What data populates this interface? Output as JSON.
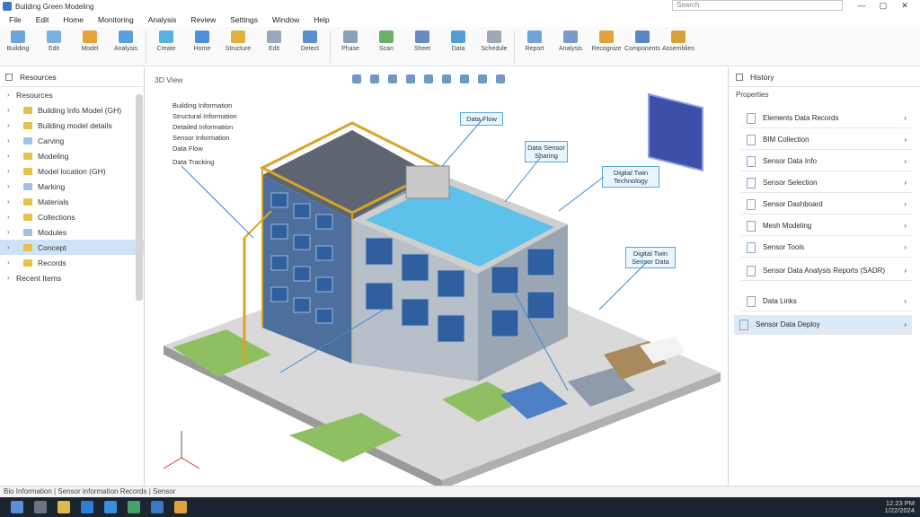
{
  "window": {
    "title": "Building Green Modeling",
    "search_placeholder": "Search",
    "controls": [
      "—",
      "▢",
      "✕"
    ]
  },
  "menu": [
    "File",
    "Edit",
    "Home",
    "Monitoring",
    "Analysis",
    "Review",
    "Settings",
    "Window",
    "Help"
  ],
  "ribbon": [
    {
      "label": "Building",
      "icon": "building-icon"
    },
    {
      "label": "Edit",
      "icon": "pencil-icon"
    },
    {
      "label": "Model",
      "icon": "box-icon"
    },
    {
      "label": "Analysis",
      "icon": "globe-icon"
    },
    {
      "label": "Create",
      "icon": "cube-icon"
    },
    {
      "label": "Home",
      "icon": "cube-icon"
    },
    {
      "label": "Structure",
      "icon": "beam-icon"
    },
    {
      "label": "Edit",
      "icon": "list-icon"
    },
    {
      "label": "Detect",
      "icon": "layers-icon"
    },
    {
      "label": "Phase",
      "icon": "phase-icon"
    },
    {
      "label": "Scan",
      "icon": "leaf-icon"
    },
    {
      "label": "Sheet",
      "icon": "sheet-icon"
    },
    {
      "label": "Data",
      "icon": "chart-icon"
    },
    {
      "label": "Schedule",
      "icon": "tag-icon"
    },
    {
      "label": "Report",
      "icon": "doc-icon"
    },
    {
      "label": "Analysis",
      "icon": "doc-icon"
    },
    {
      "label": "Recognize",
      "icon": "cube-icon"
    },
    {
      "label": "Components",
      "icon": "stack-icon"
    },
    {
      "label": "Assemblies",
      "icon": "gear-icon"
    }
  ],
  "left_panel": {
    "title": "Resources",
    "items": [
      {
        "label": "Resources",
        "folder": false,
        "selected": false
      },
      {
        "label": "Building Info Model (GH)",
        "folder": true,
        "selected": false
      },
      {
        "label": "Building model details",
        "folder": true,
        "selected": false
      },
      {
        "label": "Carving",
        "folder": true,
        "selected": false
      },
      {
        "label": "Modeling",
        "folder": true,
        "selected": false
      },
      {
        "label": "Model location (GH)",
        "folder": true,
        "selected": false
      },
      {
        "label": "Marking",
        "folder": true,
        "selected": false
      },
      {
        "label": "Materials",
        "folder": true,
        "selected": false
      },
      {
        "label": "Collections",
        "folder": true,
        "selected": false
      },
      {
        "label": "Modules",
        "folder": true,
        "selected": false
      },
      {
        "label": "Concept",
        "folder": true,
        "selected": true
      },
      {
        "label": "Records",
        "folder": true,
        "selected": false
      },
      {
        "label": "Recent Items",
        "folder": false,
        "selected": false
      }
    ]
  },
  "viewport": {
    "label": "3D View",
    "annotations": [
      "Building Information",
      "Structural Information",
      "Detailed Information",
      "Sensor Information",
      "Data Flow",
      "Data Tracking"
    ],
    "callouts": [
      "Data Flow",
      "Data Sensor Sharing",
      "Digital Twin Technology",
      "Digital Twin Sensor Data"
    ]
  },
  "right_panel": {
    "title": "History",
    "subtitle": "Properties",
    "items": [
      {
        "label": "Elements Data Records",
        "selected": false
      },
      {
        "label": "BIM Collection",
        "selected": false
      },
      {
        "label": "Sensor Data Info",
        "selected": false
      },
      {
        "label": "Sensor Selection",
        "selected": false
      },
      {
        "label": "Sensor Dashboard",
        "selected": false
      },
      {
        "label": "Mesh Modeling",
        "selected": false
      },
      {
        "label": "Sensor Tools",
        "selected": false
      },
      {
        "label": "Sensor Data Analysis Reports (SADR)",
        "selected": false
      },
      {
        "label": "Data Links",
        "selected": false
      },
      {
        "label": "Sensor Data Deploy",
        "selected": true
      }
    ]
  },
  "status": "Bio Information | Sensor information Records | Sensor",
  "tray": {
    "time": "12:23 PM",
    "date": "1/22/2024"
  },
  "colors": {
    "accent": "#3a78c4",
    "select": "#cfe3f7",
    "taskbar": "#1a2530"
  }
}
